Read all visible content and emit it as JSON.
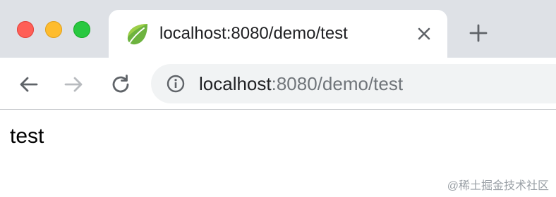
{
  "window": {
    "traffic_lights": [
      "close",
      "minimize",
      "zoom"
    ]
  },
  "tab": {
    "title": "localhost:8080/demo/test",
    "favicon": "spring-leaf-icon"
  },
  "address_bar": {
    "host": "localhost",
    "rest": ":8080/demo/test"
  },
  "page": {
    "text": "test"
  },
  "watermark": "@稀土掘金技术社区",
  "colors": {
    "tabstrip": "#dee1e6",
    "omnibox": "#f1f3f4",
    "close_light": "#ff5f57",
    "minimize_light": "#febc2e",
    "zoom_light": "#28c840",
    "favicon": "#6db33f"
  }
}
